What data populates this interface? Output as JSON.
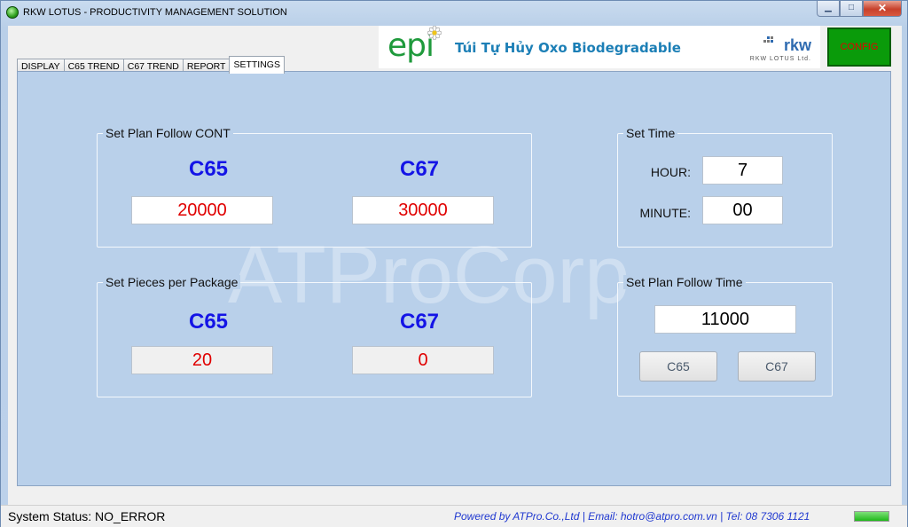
{
  "window": {
    "title": "RKW LOTUS - PRODUCTIVITY MANAGEMENT SOLUTION",
    "buttons": {
      "minimize": "▁",
      "maximize": "□",
      "close": "✕"
    }
  },
  "banner": {
    "epi": "epi",
    "text": "Túi Tự Hủy Oxo Biodegradable",
    "rkw": "rkw",
    "rkw_sub": "RKW LOTUS Ltd."
  },
  "config_button": "CONFIG",
  "tabs": [
    {
      "label": "DISPLAY",
      "active": false
    },
    {
      "label": "C65 TREND",
      "active": false
    },
    {
      "label": "C67 TREND",
      "active": false
    },
    {
      "label": "REPORT",
      "active": false
    },
    {
      "label": "SETTINGS",
      "active": true
    }
  ],
  "watermark": "ATProCorp",
  "plan_cont": {
    "title": "Set Plan Follow CONT",
    "c65_label": "C65",
    "c67_label": "C67",
    "c65_value": "20000",
    "c67_value": "30000"
  },
  "pieces": {
    "title": "Set Pieces per Package",
    "c65_label": "C65",
    "c67_label": "C67",
    "c65_value": "20",
    "c67_value": "0"
  },
  "set_time": {
    "title": "Set Time",
    "hour_label": "HOUR:",
    "minute_label": "MINUTE:",
    "hour_value": "7",
    "minute_value": "00"
  },
  "plan_time": {
    "title": "Set Plan Follow Time",
    "value": "11000",
    "btn_c65": "C65",
    "btn_c67": "C67"
  },
  "status": {
    "text": "System Status: NO_ERROR",
    "powered": "Powered by ATPro.Co.,Ltd | Email: hotro@atpro.com.vn | Tel: 08 7306 1121",
    "progress": 1.0
  },
  "colors": {
    "accent_blue": "#1414e6",
    "value_red": "#e00000",
    "config_green": "#0a9b0a",
    "page_bg": "#b9d0ea"
  }
}
